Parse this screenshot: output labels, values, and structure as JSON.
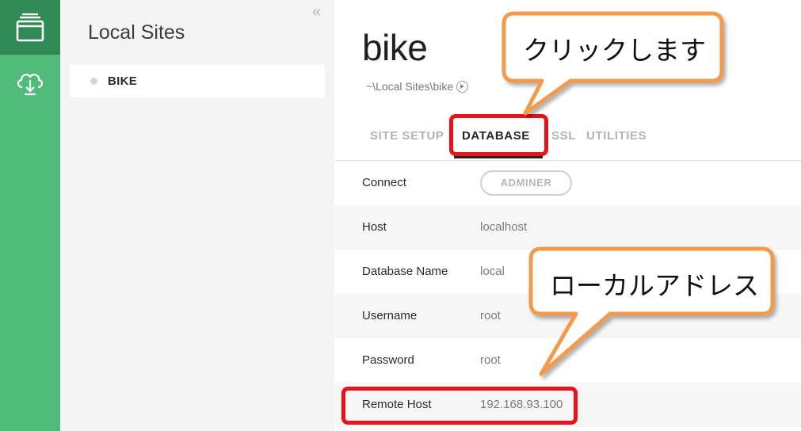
{
  "sidebar": {
    "title": "Local Sites",
    "collapse_glyph": "«",
    "sites": [
      {
        "name": "BIKE"
      }
    ]
  },
  "site": {
    "title": "bike",
    "path": "~\\Local Sites\\bike"
  },
  "tabs": [
    {
      "label": "SITE SETUP"
    },
    {
      "label": "DATABASE"
    },
    {
      "label": "SSL"
    },
    {
      "label": "UTILITIES"
    }
  ],
  "database": {
    "connect_label": "Connect",
    "adminer_label": "ADMINER",
    "rows": [
      {
        "label": "Host",
        "value": "localhost"
      },
      {
        "label": "Database Name",
        "value": "local"
      },
      {
        "label": "Username",
        "value": "root"
      },
      {
        "label": "Password",
        "value": "root"
      },
      {
        "label": "Remote Host",
        "value": "192.168.93.100"
      }
    ]
  },
  "callouts": [
    {
      "text": "クリックします"
    },
    {
      "text": "ローカルアドレス"
    }
  ],
  "colors": {
    "rail": "#51bb7b",
    "rail_active": "#2f8a53",
    "callout_border": "#f39a4b",
    "highlight_box": "#e8121b"
  },
  "icons": {
    "rail_sites": "sites-icon",
    "rail_cloud": "cloud-download-icon",
    "path_open": "reveal-arrow-icon"
  }
}
